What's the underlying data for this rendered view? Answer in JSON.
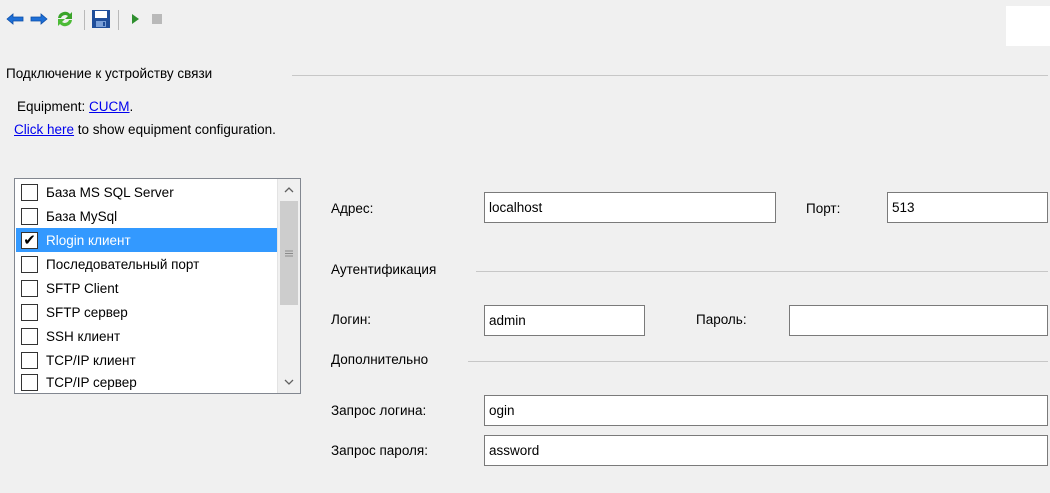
{
  "toolbar": {
    "icons": [
      "back-arrow-icon",
      "forward-arrow-icon",
      "refresh-icon",
      "save-icon",
      "play-icon",
      "stop-icon"
    ],
    "colors": {
      "arrow": "#1e6fd6",
      "refresh": "#3aa42a",
      "save": "#1f4e9a",
      "play": "#2f8f2f",
      "stop": "#b9b9b9"
    }
  },
  "connection_group": {
    "title": "Подключение к устройству связи"
  },
  "equipment": {
    "prefix": "Equipment: ",
    "name": "CUCM",
    "suffix": ".",
    "link_text": "Click here",
    "link_suffix": " to show equipment configuration."
  },
  "connection_types": {
    "items": [
      {
        "label": "База MS SQL Server",
        "checked": false,
        "selected": false
      },
      {
        "label": "База MySql",
        "checked": false,
        "selected": false
      },
      {
        "label": "Rlogin клиент",
        "checked": true,
        "selected": true
      },
      {
        "label": "Последовательный порт",
        "checked": false,
        "selected": false
      },
      {
        "label": "SFTP Client",
        "checked": false,
        "selected": false
      },
      {
        "label": "SFTP сервер",
        "checked": false,
        "selected": false
      },
      {
        "label": "SSH клиент",
        "checked": false,
        "selected": false
      },
      {
        "label": "TCP/IP клиент",
        "checked": false,
        "selected": false
      },
      {
        "label": "TCP/IP сервер",
        "checked": false,
        "selected": false
      }
    ],
    "check_mark": "✔"
  },
  "form": {
    "address_label": "Адрес:",
    "address_value": "localhost",
    "port_label": "Порт:",
    "port_value": "513",
    "auth_title": "Аутентификация",
    "login_label": "Логин:",
    "login_value": "admin",
    "password_label": "Пароль:",
    "password_value": "",
    "additional_title": "Дополнительно",
    "login_prompt_label": "Запрос логина:",
    "login_prompt_value": "ogin",
    "password_prompt_label": "Запрос пароля:",
    "password_prompt_value": "assword"
  }
}
